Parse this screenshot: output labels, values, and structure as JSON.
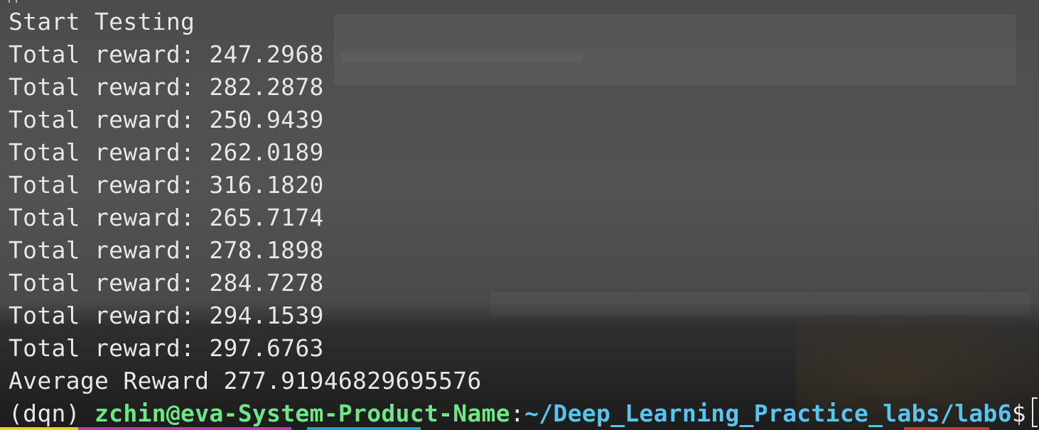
{
  "terminal": {
    "lines": [
      "Start Testing",
      "Total reward: 247.2968",
      "Total reward: 282.2878",
      "Total reward: 250.9439",
      "Total reward: 262.0189",
      "Total reward: 316.1820",
      "Total reward: 265.7174",
      "Total reward: 278.1898",
      "Total reward: 284.7278",
      "Total reward: 294.1539",
      "Total reward: 297.6763",
      "Average Reward 277.91946829695576"
    ],
    "prompt": {
      "env": "(dqn) ",
      "user_host": "zchin@eva-System-Product-Name",
      "colon": ":",
      "path": "~/Deep_Learning_Practice_labs/lab6",
      "symbol": "$"
    }
  },
  "colors": {
    "text": "#e8e8e8",
    "user_host": "#6ee787",
    "path": "#58c4f0",
    "taskbar_yellow": "#e6d61f",
    "taskbar_magenta": "#c23ab0",
    "taskbar_blue": "#2a9fd6",
    "taskbar_red": "#c83a3a"
  }
}
